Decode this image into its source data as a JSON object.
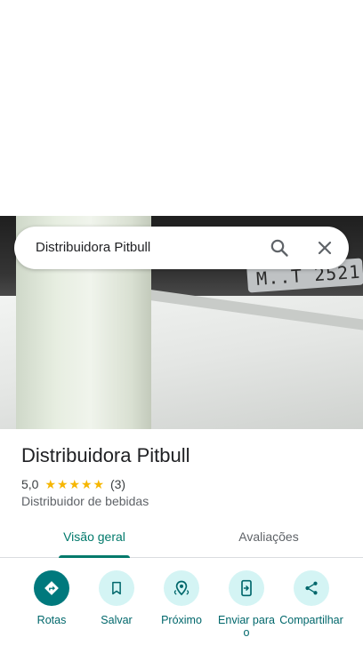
{
  "search": {
    "query": "Distribuidora Pitbull"
  },
  "photo": {
    "plate_text": "M..T 2521"
  },
  "place": {
    "name": "Distribuidora Pitbull",
    "rating": "5,0",
    "stars": 5,
    "review_count": "(3)",
    "category": "Distribuidor de bebidas"
  },
  "tabs": [
    {
      "label": "Visão geral",
      "active": true
    },
    {
      "label": "Avaliações",
      "active": false
    }
  ],
  "actions": [
    {
      "label": "Rotas",
      "icon": "directions-icon"
    },
    {
      "label": "Salvar",
      "icon": "bookmark-icon"
    },
    {
      "label": "Próximo",
      "icon": "nearby-icon"
    },
    {
      "label": "Enviar para o",
      "icon": "send-to-phone-icon"
    },
    {
      "label": "Compartilhar",
      "icon": "share-icon"
    }
  ],
  "colors": {
    "accent": "#00796b",
    "action_bg": "#d4f4f4",
    "primary_action": "#00797d",
    "star": "#f6b600"
  }
}
